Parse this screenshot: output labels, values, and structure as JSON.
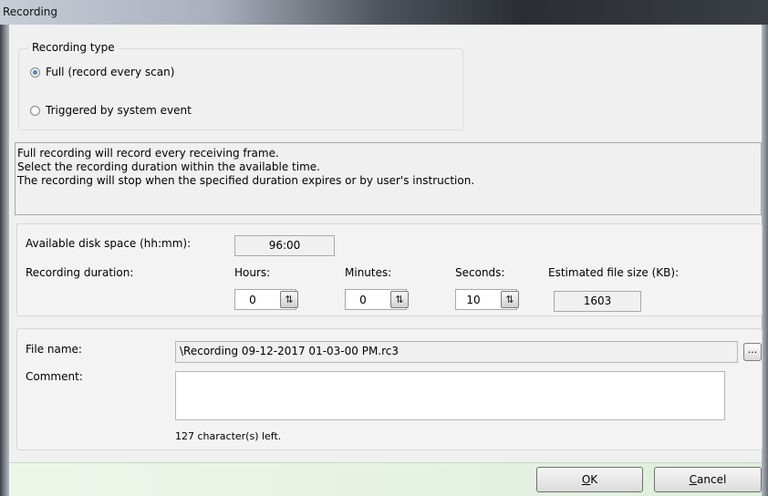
{
  "window": {
    "title": "Recording"
  },
  "recording_type": {
    "legend": "Recording type",
    "options": [
      {
        "label": "Full (record every scan)",
        "selected": true
      },
      {
        "label": "Triggered by system event",
        "selected": false
      }
    ]
  },
  "info": {
    "lines": [
      "Full recording will record every receiving frame.",
      "Select the recording duration within the available time.",
      "The recording will stop when the specified duration expires or by user's instruction."
    ]
  },
  "duration": {
    "disk_label": "Available disk space (hh:mm):",
    "disk_value": "96:00",
    "duration_label": "Recording duration:",
    "hours_label": "Hours:",
    "hours_value": "0",
    "minutes_label": "Minutes:",
    "minutes_value": "0",
    "seconds_label": "Seconds:",
    "seconds_value": "10",
    "size_label": "Estimated file size (KB):",
    "size_value": "1603"
  },
  "file": {
    "name_label": "File name:",
    "name_value": "\\Recording 09-12-2017  01-03-00 PM.rc3",
    "browse_label": "...",
    "comment_label": "Comment:",
    "comment_value": "",
    "chars_left": "127 character(s) left."
  },
  "buttons": {
    "ok_mnemonic": "O",
    "ok_rest": "K",
    "cancel_mnemonic": "C",
    "cancel_rest": "ancel"
  }
}
